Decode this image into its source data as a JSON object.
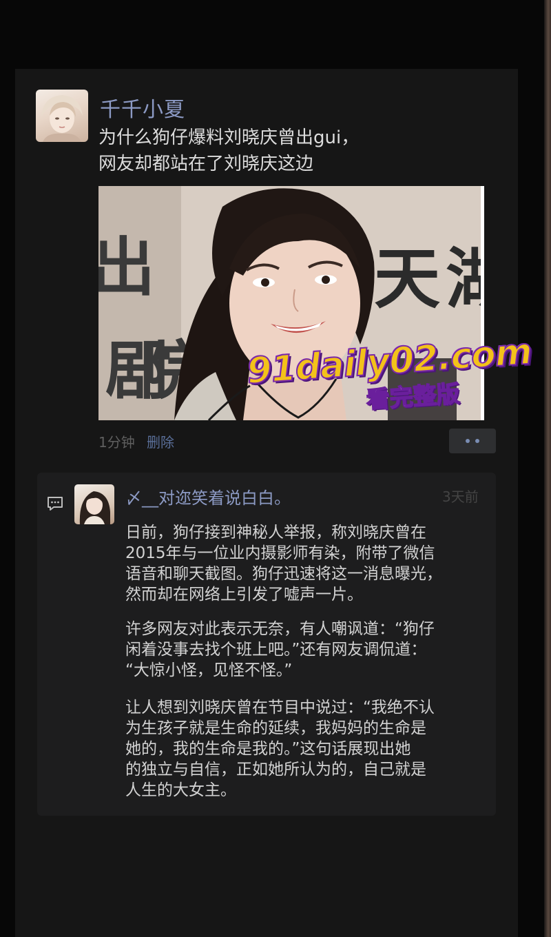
{
  "post": {
    "author": "千千小夏",
    "text_lines": [
      "为什么狗仔爆料刘晓庆曾出gui，",
      "网友却都站在了刘晓庆这边"
    ],
    "time": "1分钟",
    "delete_label": "删除"
  },
  "watermark": {
    "url": "91daily02.com",
    "tag": "看完整版"
  },
  "comment": {
    "author": "〆__对迩笑着说白白。",
    "time": "3天前",
    "lines": [
      "日前，狗仔接到神秘人举报，称刘晓庆曾在",
      "2015年与一位业内摄影师有染，附带了微信",
      "语音和聊天截图。狗仔迅速将这一消息曝光，",
      "然而却在网络上引发了嘘声一片。",
      "许多网友对此表示无奈，有人嘲讽道：“狗仔",
      "闲着没事去找个班上吧。”还有网友调侃道：",
      "“大惊小怪，见怪不怪。”",
      "让人想到刘晓庆曾在节目中说过：“我绝不认",
      "为生孩子就是生命的延续，我妈妈的生命是",
      "她的，我的生命是我的。”这句话展现出她",
      "的独立与自信，正如她所认为的，自己就是",
      "人生的大女主。"
    ]
  },
  "colors": {
    "background": "#070707",
    "card": "#161616",
    "comment_box": "#1d1d1e",
    "author_name": "#8c9ac4",
    "link": "#5a6f99",
    "body_text": "#dddddd",
    "watermark_yellow": "#f3c21a",
    "watermark_purple": "#7a2aa8"
  },
  "icons": {
    "comment": "comment-bubble-icon",
    "more": "more-dots-icon"
  }
}
